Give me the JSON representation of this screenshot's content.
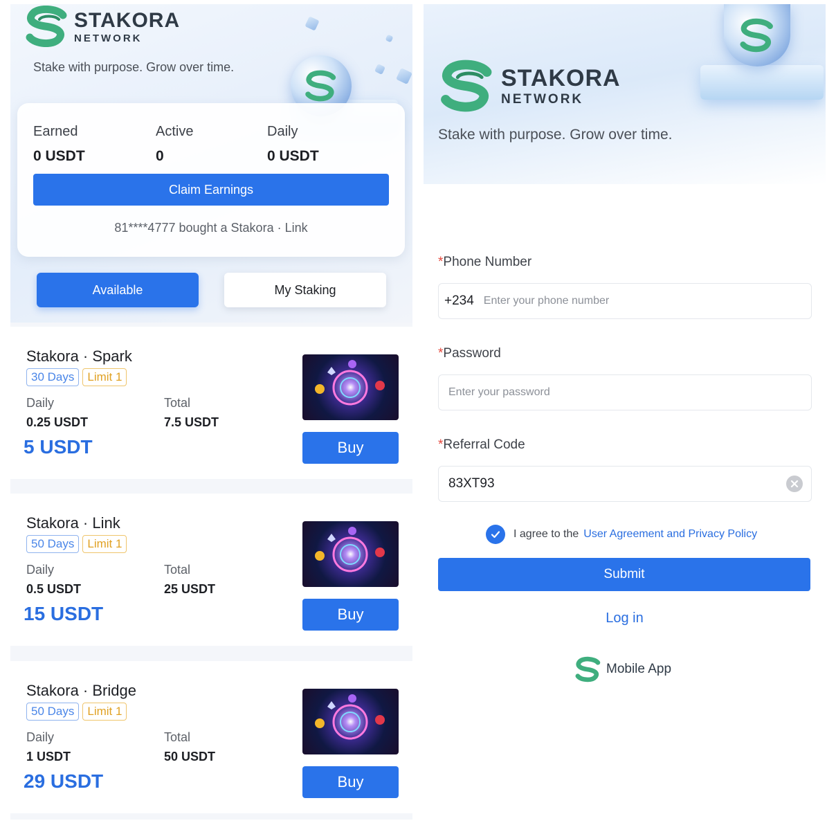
{
  "brand": {
    "name": "STAKORA",
    "sub": "NETWORK",
    "tagline": "Stake with purpose. Grow over time."
  },
  "dashboard": {
    "stats": [
      {
        "label": "Earned",
        "value": "0 USDT"
      },
      {
        "label": "Active",
        "value": "0"
      },
      {
        "label": "Daily",
        "value": "0 USDT"
      }
    ],
    "claim_label": "Claim Earnings",
    "ticker": "81****4777 bought a Stakora · Link",
    "tabs": [
      {
        "label": "Available",
        "active": true
      },
      {
        "label": "My Staking",
        "active": false
      }
    ],
    "daily_label": "Daily",
    "total_label": "Total",
    "buy_label": "Buy",
    "products": [
      {
        "name": "Stakora · Spark",
        "days": "30 Days",
        "limit": "Limit 1",
        "daily": "0.25 USDT",
        "total": "7.5 USDT",
        "price": "5 USDT"
      },
      {
        "name": "Stakora · Link",
        "days": "50 Days",
        "limit": "Limit 1",
        "daily": "0.5 USDT",
        "total": "25 USDT",
        "price": "15 USDT"
      },
      {
        "name": "Stakora · Bridge",
        "days": "50 Days",
        "limit": "Limit 1",
        "daily": "1 USDT",
        "total": "50 USDT",
        "price": "29 USDT"
      }
    ]
  },
  "register": {
    "required_mark": "*",
    "phone": {
      "label": "Phone Number",
      "prefix": "+234",
      "placeholder": "Enter your phone number"
    },
    "password": {
      "label": "Password",
      "placeholder": "Enter your password"
    },
    "referral": {
      "label": "Referral Code",
      "value": "83XT93"
    },
    "agree_text": "I agree to the",
    "policy_link": "User Agreement and Privacy Policy",
    "agreed": true,
    "submit_label": "Submit",
    "login_label": "Log in",
    "mobile_app_label": "Mobile App"
  },
  "colors": {
    "accent": "#2a73ea",
    "brand_green": "#3fae7e",
    "tag_blue": "#4a86e8",
    "tag_gold": "#e0a123"
  }
}
